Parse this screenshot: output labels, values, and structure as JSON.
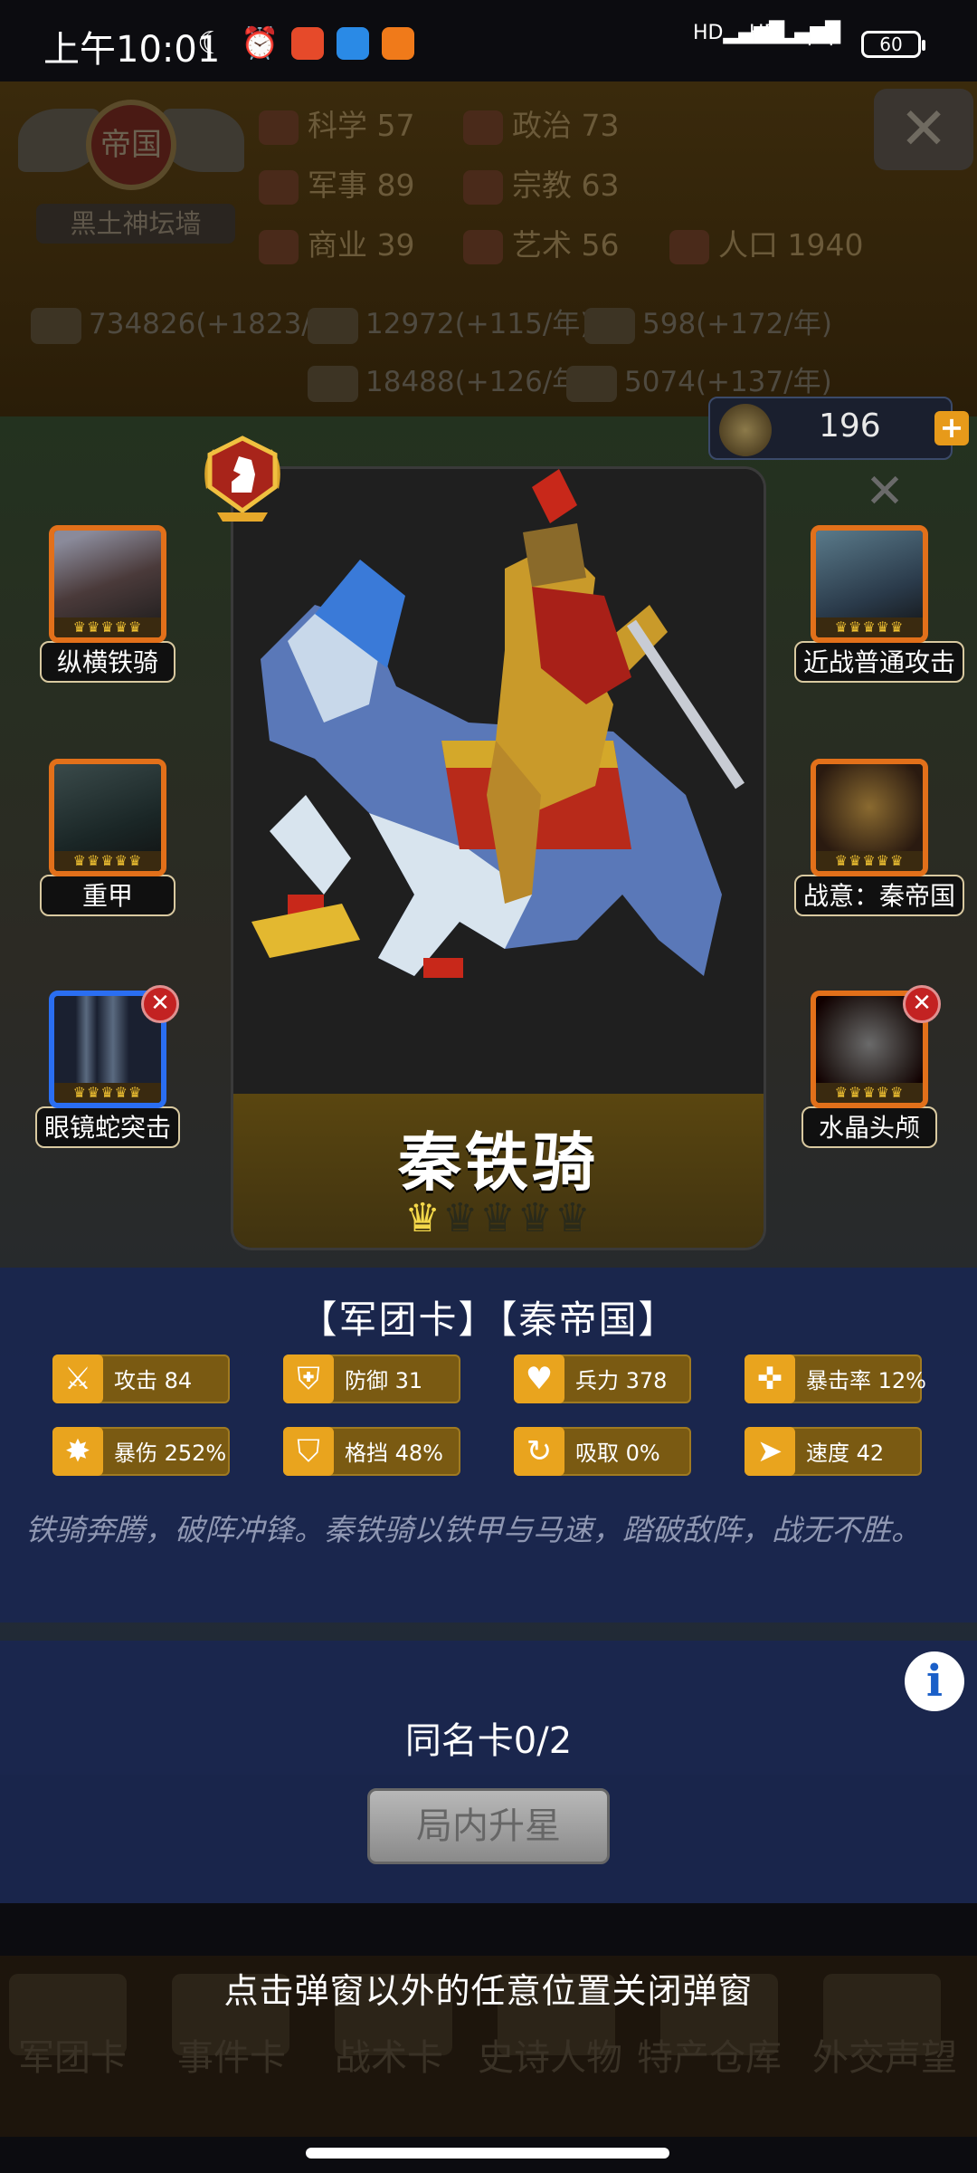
{
  "status_bar": {
    "time": "上午10:01",
    "battery": "60",
    "signal_label": "HD"
  },
  "empire": {
    "emblem_text": "帝国",
    "name": "黑土神坛墙"
  },
  "stats": [
    {
      "name": "科学",
      "value": "57"
    },
    {
      "name": "政治",
      "value": "73"
    },
    {
      "name": "军事",
      "value": "89"
    },
    {
      "name": "宗教",
      "value": "63"
    },
    {
      "name": "商业",
      "value": "39"
    },
    {
      "name": "艺术",
      "value": "56"
    },
    {
      "name": "人口",
      "value": "1940"
    }
  ],
  "resources": [
    "734826(+1823/年)",
    "12972(+115/年)",
    "598(+172/年)",
    "18488(+126/年)",
    "5074(+137/年)"
  ],
  "currency": {
    "value": "196",
    "plus": "+"
  },
  "side_cards": {
    "left": [
      {
        "label": "纵横铁骑",
        "crowns": "♛♛♛♛♛"
      },
      {
        "label": "重甲",
        "crowns": "♛♛♛♛♛"
      },
      {
        "label": "眼镜蛇突击",
        "crowns": "♛♛♛♛♛"
      }
    ],
    "right": [
      {
        "label": "近战普通攻击",
        "crowns": "♛♛♛♛♛"
      },
      {
        "label": "战意：秦帝国",
        "crowns": "♛♛♛♛♛"
      },
      {
        "label": "水晶头颅",
        "crowns": "♛♛♛♛♛"
      }
    ],
    "remove_icon": "✕"
  },
  "card": {
    "name": "秦铁骑",
    "stars_filled": 1,
    "stars_total": 5,
    "tags": "【军团卡】【秦帝国】",
    "attributes": [
      {
        "label": "攻击 84",
        "icon": "sword-icon"
      },
      {
        "label": "防御 31",
        "icon": "shield-icon"
      },
      {
        "label": "兵力 378",
        "icon": "heart-icon"
      },
      {
        "label": "暴击率 12%",
        "icon": "crosshair-icon"
      },
      {
        "label": "暴伤 252%",
        "icon": "burst-icon"
      },
      {
        "label": "格挡 48%",
        "icon": "block-icon"
      },
      {
        "label": "吸取 0%",
        "icon": "drain-icon"
      },
      {
        "label": "速度 42",
        "icon": "boot-icon"
      }
    ],
    "description": "铁骑奔腾，破阵冲锋。秦铁骑以铁甲与马速，踏破敌阵，战无不胜。"
  },
  "same_card": "同名卡0/2",
  "upgrade_button": "局内升星",
  "info_button": "i",
  "close_hint": "点击弹窗以外的任意位置关闭弹窗",
  "bottom_tabs": [
    "军团卡",
    "事件卡",
    "战术卡",
    "史诗人物",
    "特产仓库",
    "外交声望"
  ],
  "colors": {
    "accent": "#e9a41e",
    "panel": "#1a264e",
    "card_border_orange": "#e2701a",
    "card_border_blue": "#2a6ef2"
  }
}
